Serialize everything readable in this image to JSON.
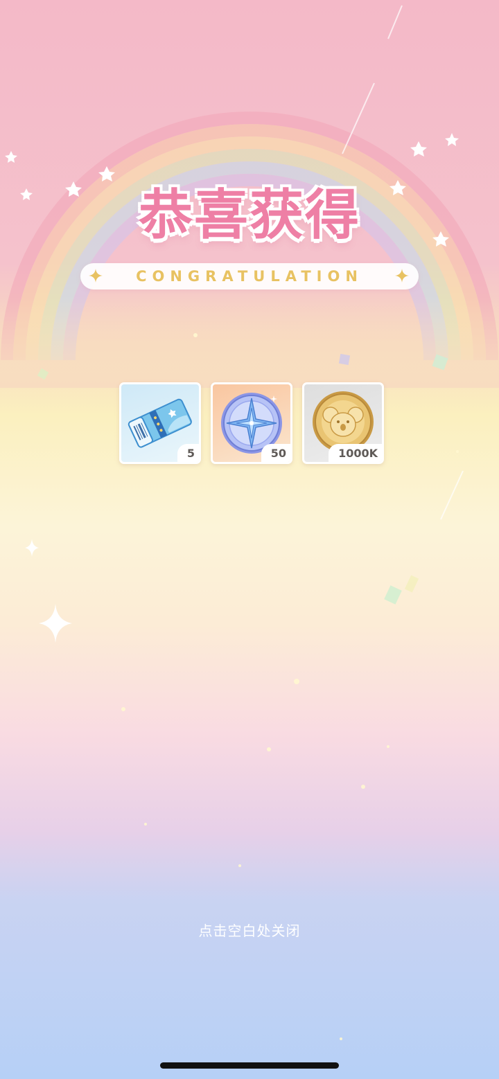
{
  "title": "恭喜获得",
  "subtitle": "CONGRATULATION",
  "rewards": [
    {
      "name": "ticket",
      "icon": "ticket-icon",
      "count": "5"
    },
    {
      "name": "compass-coin",
      "icon": "compass-coin-icon",
      "count": "50"
    },
    {
      "name": "koala-gold-coin",
      "icon": "koala-coin-icon",
      "count": "1000K"
    }
  ],
  "close_hint": "点击空白处关闭",
  "colors": {
    "title_pink": "#ee7fa5",
    "subtitle_gold": "#e8c262",
    "bg_top": "#f4b9c8",
    "bg_mid": "#fbf0bf",
    "bg_bottom": "#b6d0f6"
  }
}
